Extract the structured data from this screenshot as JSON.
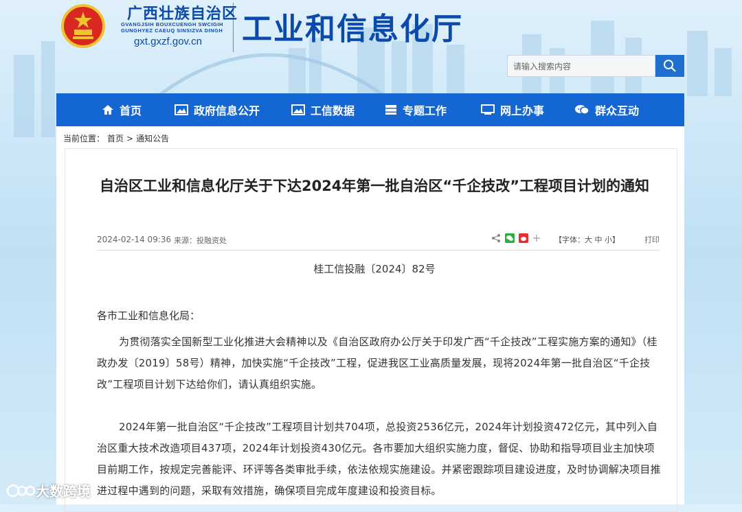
{
  "header": {
    "org_name": "广西壮族自治区",
    "org_zhuang_line1": "GVANGJSIH BOUXCUENGH SWCIGIH",
    "org_zhuang_line2": "GUNGHYEZ CAEUQ SINSIZVA DINGH",
    "site_url": "gxt.gxzf.gov.cn",
    "department": "工业和信息化厅"
  },
  "search": {
    "placeholder": "请输入搜索内容"
  },
  "nav": {
    "items": [
      {
        "label": "首页",
        "icon": "home-icon"
      },
      {
        "label": "政府信息公开",
        "icon": "image-icon"
      },
      {
        "label": "工信数据",
        "icon": "image-icon"
      },
      {
        "label": "专题工作",
        "icon": "stack-icon"
      },
      {
        "label": "网上办事",
        "icon": "monitor-icon"
      },
      {
        "label": "群众互动",
        "icon": "chat-icon"
      }
    ]
  },
  "breadcrumb": {
    "prefix": "当前位置：",
    "home": "首页",
    "sep": ">",
    "current": "通知公告"
  },
  "article": {
    "title": "自治区工业和信息化厅关于下达2024年第一批自治区“千企技改”工程项目计划的通知",
    "date": "2024-02-14 09:36",
    "source": "来源：投融资处",
    "font_control": "【字体：大 中 小】",
    "print": "打印",
    "doc_number": "桂工信投融〔2024〕82号",
    "salutation": "各市工业和信息化局：",
    "paragraphs": [
      "为贯彻落实全国新型工业化推进大会精神以及《自治区政府办公厅关于印发广西“千企技改”工程实施方案的通知》（桂政办发〔2019〕58号）精神，加快实施“千企技改”工程，促进我区工业高质量发展，现将2024年第一批自治区“千企技改”工程项目计划下达给你们，请认真组织实施。",
      "2024年第一批自治区“千企技改”工程项目计划共704项，总投资2536亿元，2024年计划投资472亿元，其中列入自治区重大技术改造项目437项，2024年计划投资430亿元。各市要加大组织实施力度，督促、协助和指导项目业主加快项目前期工作，按规定完善能评、环评等各类审批手续，依法依规实施建设。并紧密跟踪项目建设进度，及时协调解决项目推进过程中遇到的问题，采取有效措施，确保项目完成年度建设和投资目标。"
    ]
  },
  "watermark": {
    "text": "大数跨境"
  },
  "colors": {
    "brand_blue": "#1466d2",
    "title_blue": "#0b4aa8"
  }
}
